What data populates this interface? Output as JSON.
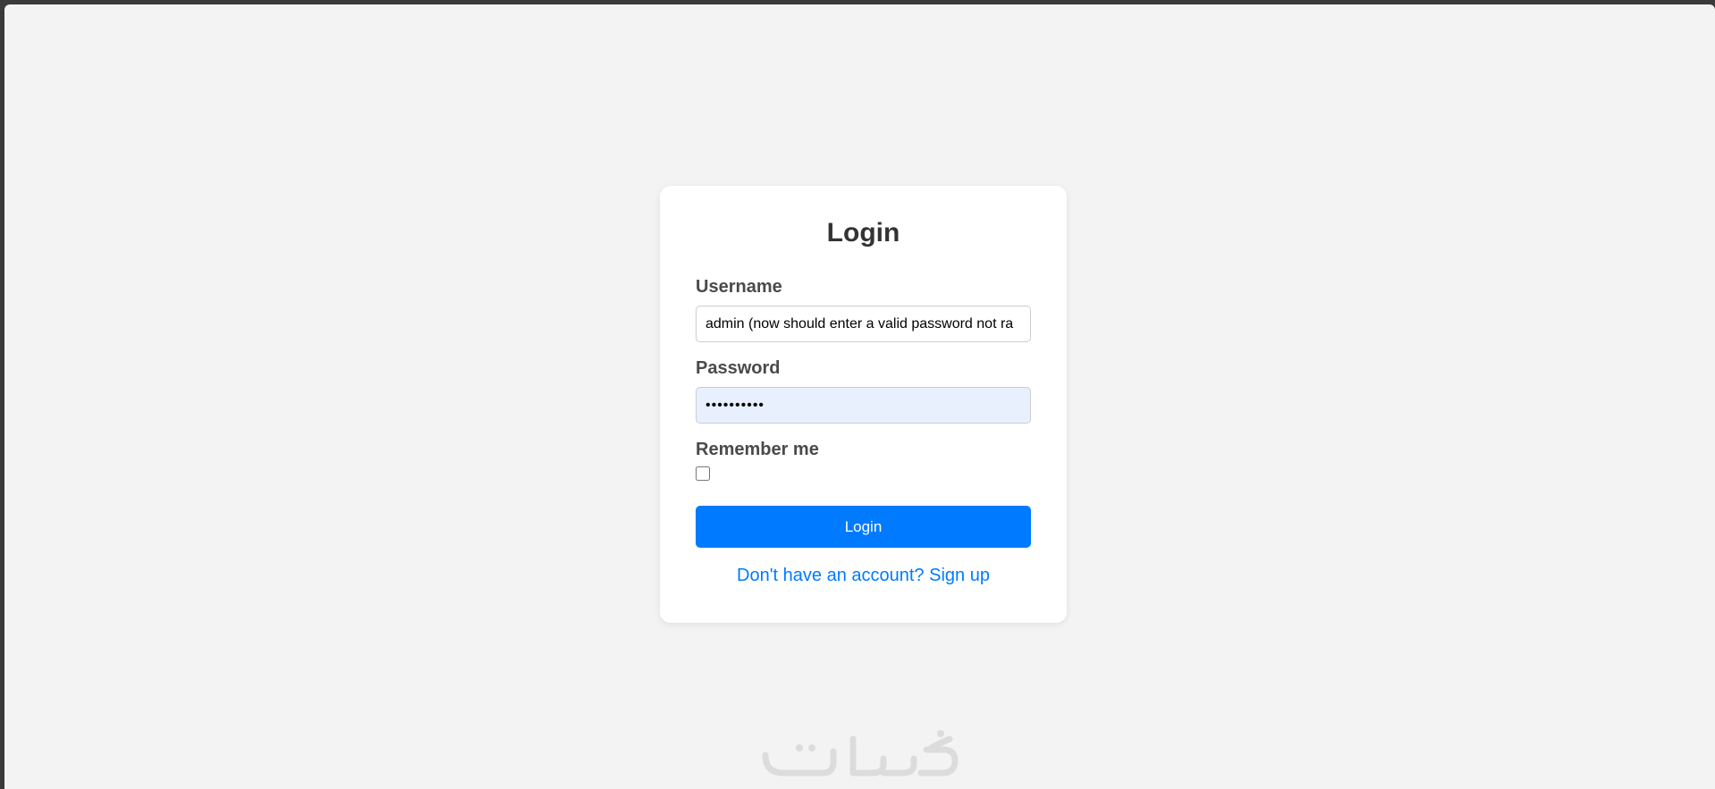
{
  "login_form": {
    "title": "Login",
    "username_label": "Username",
    "username_value": "admin (now should enter a valid password not ra",
    "password_label": "Password",
    "password_value": "••••••••••",
    "remember_label": "Remember me",
    "remember_checked": false,
    "submit_label": "Login",
    "signup_link": "Don't have an account? Sign up"
  },
  "watermark": {
    "text": "خكسات"
  },
  "colors": {
    "accent": "#007bff",
    "page_background": "#f3f3f3",
    "card_background": "#ffffff",
    "autofill_background": "#e8f0fe"
  }
}
